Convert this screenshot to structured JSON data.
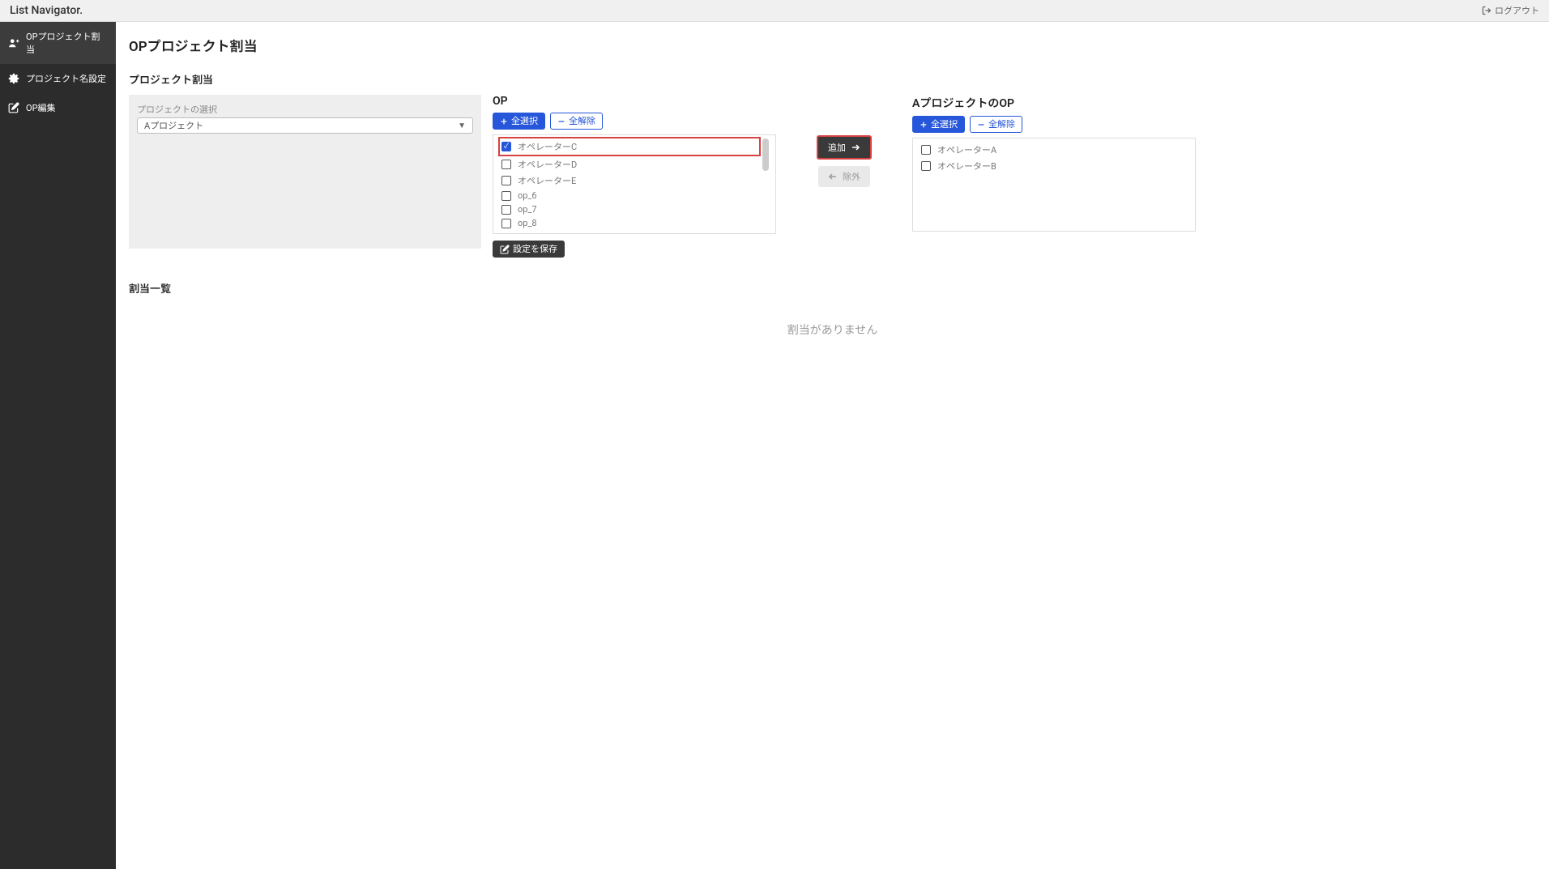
{
  "header": {
    "title": "List Navigator.",
    "logout": "ログアウト"
  },
  "sidebar": {
    "items": [
      {
        "label": "OPプロジェクト割当",
        "icon": "user-assign-icon",
        "active": true
      },
      {
        "label": "プロジェクト名設定",
        "icon": "gear-icon",
        "active": false
      },
      {
        "label": "OP編集",
        "icon": "edit-icon",
        "active": false
      }
    ]
  },
  "page": {
    "title": "OPプロジェクト割当",
    "section_assign": "プロジェクト割当",
    "section_list": "割当一覧",
    "empty_message": "割当がありません"
  },
  "project_select": {
    "label": "プロジェクトの選択",
    "value": "Aプロジェクト"
  },
  "op_panel": {
    "heading": "OP",
    "select_all": "全選択",
    "deselect_all": "全解除",
    "save": "設定を保存",
    "items": [
      {
        "label": "オペレーターC",
        "checked": true,
        "highlighted": true
      },
      {
        "label": "オペレーターD",
        "checked": false,
        "highlighted": false
      },
      {
        "label": "オペレーターE",
        "checked": false,
        "highlighted": false
      },
      {
        "label": "op_6",
        "checked": false,
        "highlighted": false
      },
      {
        "label": "op_7",
        "checked": false,
        "highlighted": false
      },
      {
        "label": "op_8",
        "checked": false,
        "highlighted": false
      }
    ]
  },
  "transfer": {
    "add": "追加",
    "remove": "除外"
  },
  "assigned_panel": {
    "heading": "AプロジェクトのOP",
    "select_all": "全選択",
    "deselect_all": "全解除",
    "items": [
      {
        "label": "オペレーターA",
        "checked": false
      },
      {
        "label": "オペレーターB",
        "checked": false
      }
    ]
  }
}
